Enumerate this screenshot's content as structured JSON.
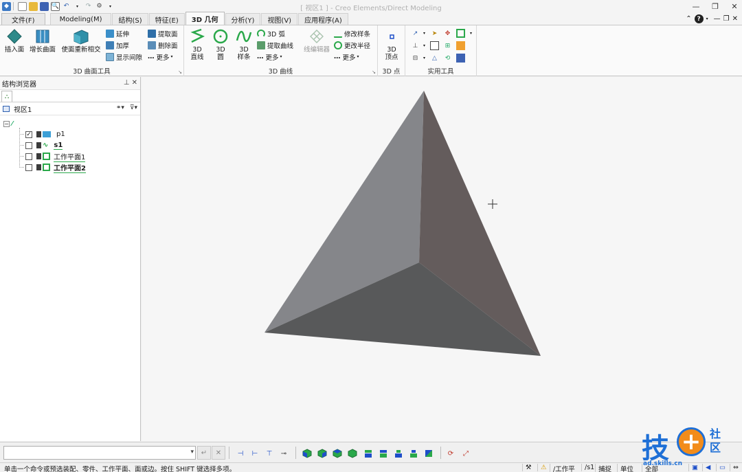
{
  "window": {
    "title": "[ 视区1 ] - Creo Elements/Direct Modeling"
  },
  "tabs": [
    {
      "label": "文件(F)"
    },
    {
      "label": "Modeling(M)"
    },
    {
      "label": "结构(S)"
    },
    {
      "label": "特征(E)"
    },
    {
      "label": "3D 几何"
    },
    {
      "label": "分析(Y)"
    },
    {
      "label": "视图(V)"
    },
    {
      "label": "应用程序(A)"
    }
  ],
  "ribbon": {
    "surface_group": {
      "label": "3D 曲面工具",
      "big_buttons": [
        "插入面",
        "增长曲面",
        "使面重新相交"
      ],
      "small_col1": [
        "延伸",
        "加厚",
        "显示间隙"
      ],
      "small_col2": [
        "提取面",
        "删除面",
        "更多"
      ]
    },
    "curve_group": {
      "label": "3D 曲线",
      "big_buttons": [
        {
          "line1": "3D",
          "line2": "直线"
        },
        {
          "line1": "3D",
          "line2": "圆"
        },
        {
          "line1": "3D",
          "line2": "样条"
        }
      ],
      "small_col1": [
        "3D 弧",
        "提取曲线",
        "更多"
      ],
      "editor": "线编辑器",
      "small_col2": [
        "修改样条",
        "更改半径",
        "更多"
      ]
    },
    "point_group": {
      "label": "3D 点",
      "big_button": {
        "line1": "3D",
        "line2": "顶点"
      }
    },
    "util_group": {
      "label": "实用工具"
    }
  },
  "browser": {
    "title": "结构浏览器",
    "view_label": "视区1",
    "items": [
      {
        "label": "p1",
        "checked": true
      },
      {
        "label": "s1",
        "checked": false
      },
      {
        "label": "工作平面1",
        "checked": false
      },
      {
        "label": "工作平面2",
        "checked": false
      }
    ]
  },
  "status": {
    "message": "单击一个命令或预选装配、零件、工作平面、面或边。按住 SHIFT 键选择多项。",
    "workplane": "/工作平",
    "active_part": "/s1",
    "catch": "捕捉",
    "units": "单位",
    "all": "全部"
  },
  "watermark": {
    "main": "技",
    "plus": "+",
    "side": "社区",
    "url": "ad.skills.cn"
  },
  "colors": {
    "face_left": "#85868a",
    "face_right": "#645c5c",
    "face_bottom": "#58595a",
    "accent_green": "#2aa84a",
    "accent_blue": "#1e6fd6"
  }
}
